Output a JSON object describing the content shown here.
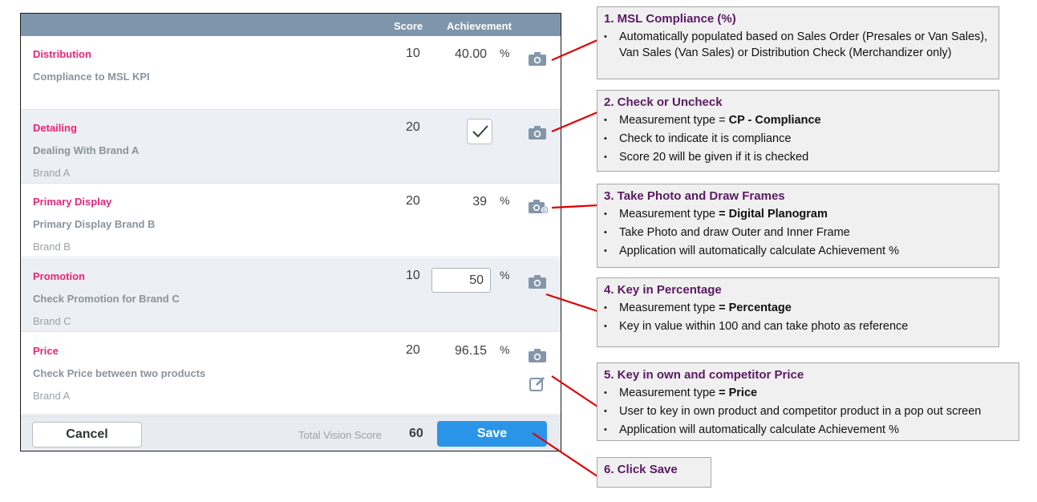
{
  "header": {
    "score_label": "Score",
    "achievement_label": "Achievement"
  },
  "rows": [
    {
      "title": "Distribution",
      "subtitle": "Compliance to MSL KPI",
      "brand": "",
      "score": "10",
      "achievement": "40.00",
      "percent": "%"
    },
    {
      "title": "Detailing",
      "subtitle": "Dealing With Brand A",
      "brand": "Brand A",
      "score": "20",
      "achievement_checked": true
    },
    {
      "title": "Primary Display",
      "subtitle": "Primary Display Brand B",
      "brand": "Brand B",
      "score": "20",
      "achievement": "39",
      "percent": "%"
    },
    {
      "title": "Promotion",
      "subtitle": "Check Promotion for Brand C",
      "brand": "Brand C",
      "score": "10",
      "achievement": "50",
      "percent": "%"
    },
    {
      "title": "Price",
      "subtitle": "Check Price between two products",
      "brand": "Brand A",
      "score": "20",
      "achievement": "96.15",
      "percent": "%"
    }
  ],
  "footer": {
    "cancel_label": "Cancel",
    "total_label": "Total Vision Score",
    "total_value": "60",
    "save_label": "Save"
  },
  "icons": {
    "camera": "camera-icon",
    "digital_planogram": "camera-planogram-icon",
    "edit": "edit-icon",
    "check": "checkmark-icon"
  },
  "colors": {
    "header": "#7f95ab",
    "row_title": "#e8267a",
    "save_button": "#2a95e8",
    "callout_title": "#5a1a63",
    "connector": "#e00000"
  },
  "callouts": [
    {
      "title": "1. MSL Compliance (%)",
      "bullets": [
        {
          "text": "Automatically populated based on Sales Order (Presales or Van Sales), Van Sales (Van Sales) or Distribution Check (Merchandizer only)"
        }
      ]
    },
    {
      "title": "2. Check or Uncheck",
      "bullets": [
        {
          "prefix": "Measurement type = ",
          "bold": "CP - Compliance"
        },
        {
          "text": "Check to indicate it is compliance"
        },
        {
          "text": "Score 20 will be given if it is checked"
        }
      ]
    },
    {
      "title": "3. Take Photo and Draw Frames",
      "bullets": [
        {
          "prefix": "Measurement type ",
          "bold": "= Digital Planogram"
        },
        {
          "text": "Take Photo and draw Outer and Inner Frame"
        },
        {
          "text": "Application will automatically calculate Achievement %"
        }
      ]
    },
    {
      "title": "4. Key in Percentage",
      "bullets": [
        {
          "prefix": "Measurement type ",
          "bold": "= Percentage"
        },
        {
          "text": "Key in value within 100 and can take photo as reference"
        }
      ]
    },
    {
      "title": "5. Key in own and competitor Price",
      "bullets": [
        {
          "prefix": "Measurement type ",
          "bold": "= Price"
        },
        {
          "text": "User to key in own product and competitor product in a pop out screen"
        },
        {
          "text": "Application will automatically calculate Achievement %"
        }
      ]
    },
    {
      "title": "6. Click Save",
      "bullets": []
    }
  ]
}
